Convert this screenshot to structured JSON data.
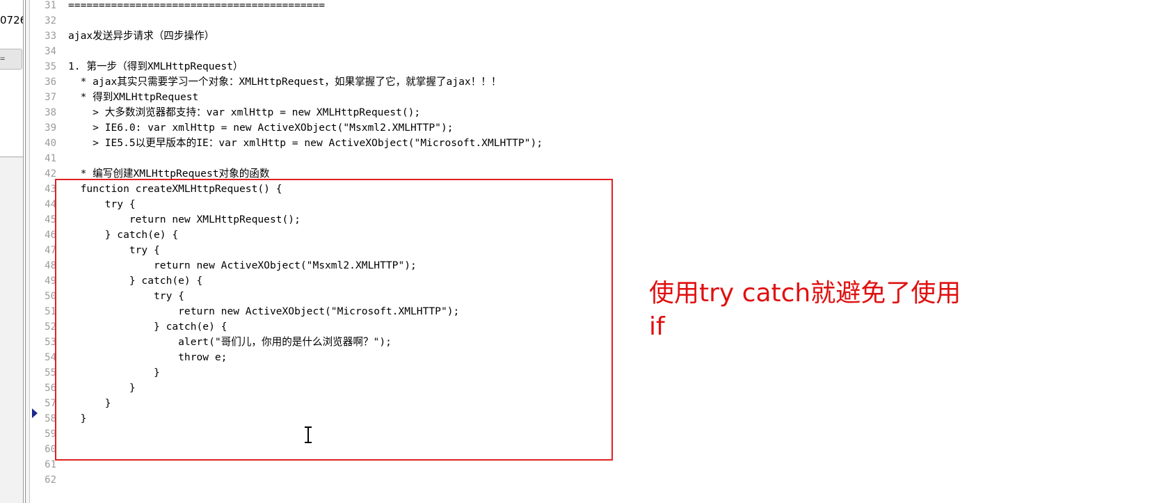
{
  "left_panel": {
    "number_label": "0726",
    "button_label": "="
  },
  "editor": {
    "lines": [
      {
        "no": "31",
        "text": "=========================================="
      },
      {
        "no": "32",
        "text": ""
      },
      {
        "no": "33",
        "text": "ajax发送异步请求（四步操作）"
      },
      {
        "no": "34",
        "text": ""
      },
      {
        "no": "35",
        "text": "1. 第一步（得到XMLHttpRequest）"
      },
      {
        "no": "36",
        "text": "  * ajax其实只需要学习一个对象：XMLHttpRequest，如果掌握了它，就掌握了ajax！！！"
      },
      {
        "no": "37",
        "text": "  * 得到XMLHttpRequest"
      },
      {
        "no": "38",
        "text": "    > 大多数浏览器都支持：var xmlHttp = new XMLHttpRequest();"
      },
      {
        "no": "39",
        "text": "    > IE6.0: var xmlHttp = new ActiveXObject(\"Msxml2.XMLHTTP\");"
      },
      {
        "no": "40",
        "text": "    > IE5.5以更早版本的IE：var xmlHttp = new ActiveXObject(\"Microsoft.XMLHTTP\");"
      },
      {
        "no": "41",
        "text": ""
      },
      {
        "no": "42",
        "text": "  * 编写创建XMLHttpRequest对象的函数"
      },
      {
        "no": "43",
        "text": "  function createXMLHttpRequest() {"
      },
      {
        "no": "44",
        "text": "      try {"
      },
      {
        "no": "45",
        "text": "          return new XMLHttpRequest();"
      },
      {
        "no": "46",
        "text": "      } catch(e) {"
      },
      {
        "no": "47",
        "text": "          try {"
      },
      {
        "no": "48",
        "text": "              return new ActiveXObject(\"Msxml2.XMLHTTP\");"
      },
      {
        "no": "49",
        "text": "          } catch(e) {"
      },
      {
        "no": "50",
        "text": "              try {"
      },
      {
        "no": "51",
        "text": "                  return new ActiveXObject(\"Microsoft.XMLHTTP\");"
      },
      {
        "no": "52",
        "text": "              } catch(e) {"
      },
      {
        "no": "53",
        "text": "                  alert(\"哥们儿，你用的是什么浏览器啊？\");"
      },
      {
        "no": "54",
        "text": "                  throw e;"
      },
      {
        "no": "55",
        "text": "              }"
      },
      {
        "no": "56",
        "text": "          }"
      },
      {
        "no": "57",
        "text": "      }"
      },
      {
        "no": "58",
        "text": "  }"
      },
      {
        "no": "59",
        "text": ""
      },
      {
        "no": "60",
        "text": ""
      },
      {
        "no": "61",
        "text": ""
      },
      {
        "no": "62",
        "text": ""
      }
    ]
  },
  "annotation": {
    "text_line1": "使用try  catch就避免了使用",
    "text_line2": "if"
  },
  "colors": {
    "annotation": "#e01010",
    "box": "#e02020",
    "line_number": "#9a9a9a"
  },
  "icons": {
    "breakpoint": "current-line-arrow-icon",
    "cursor": "text-cursor-icon"
  }
}
